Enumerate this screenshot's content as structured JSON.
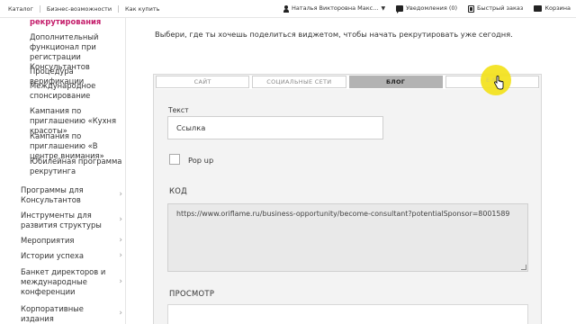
{
  "topbar": {
    "nav": [
      "Каталог",
      "Бизнес-возможности",
      "Как купить"
    ],
    "user_name": "Наталья Викторовна Макс...",
    "notifications_label": "Уведомления (0)",
    "quick_order_label": "Быстрый заказ",
    "cart_label": "Корзина"
  },
  "sidebar": {
    "sub_items": [
      "рекрутирования",
      "Дополнительный функционал при регистрации Консультантов",
      "Процедура верификации",
      "Международное спонсирование",
      "Кампания по приглашению «Кухня красоты»",
      "Кампания по приглашению «В центре внимания»",
      "Юбилейная программа рекрутинга"
    ],
    "main_items": [
      "Программы для Консультантов",
      "Инструменты для развития структуры",
      "Мероприятия",
      "Истории успеха",
      "Банкет директоров и международные конференции",
      "Корпоративные издания"
    ],
    "chevron": "›"
  },
  "intro_text": "Выбери, где ты хочешь поделиться виджетом, чтобы начать рекрутировать уже сегодня.",
  "tabs": [
    "САЙТ",
    "СОЦИАЛЬНЫЕ СЕТИ",
    "БЛОГ",
    "E-MAIL"
  ],
  "hover_tab_text": "E-M",
  "form": {
    "text_label": "Текст",
    "text_value": "Ссылка",
    "popup_label": "Pop up",
    "code_label": "КОД",
    "code_value": "https://www.oriflame.ru/business-opportunity/become-consultant?potentialSponsor=8001589",
    "preview_label": "ПРОСМОТР"
  },
  "colors": {
    "accent": "#c41e6b",
    "active_tab": "#b3b3b3",
    "cursor_highlight": "#f3e21b"
  }
}
